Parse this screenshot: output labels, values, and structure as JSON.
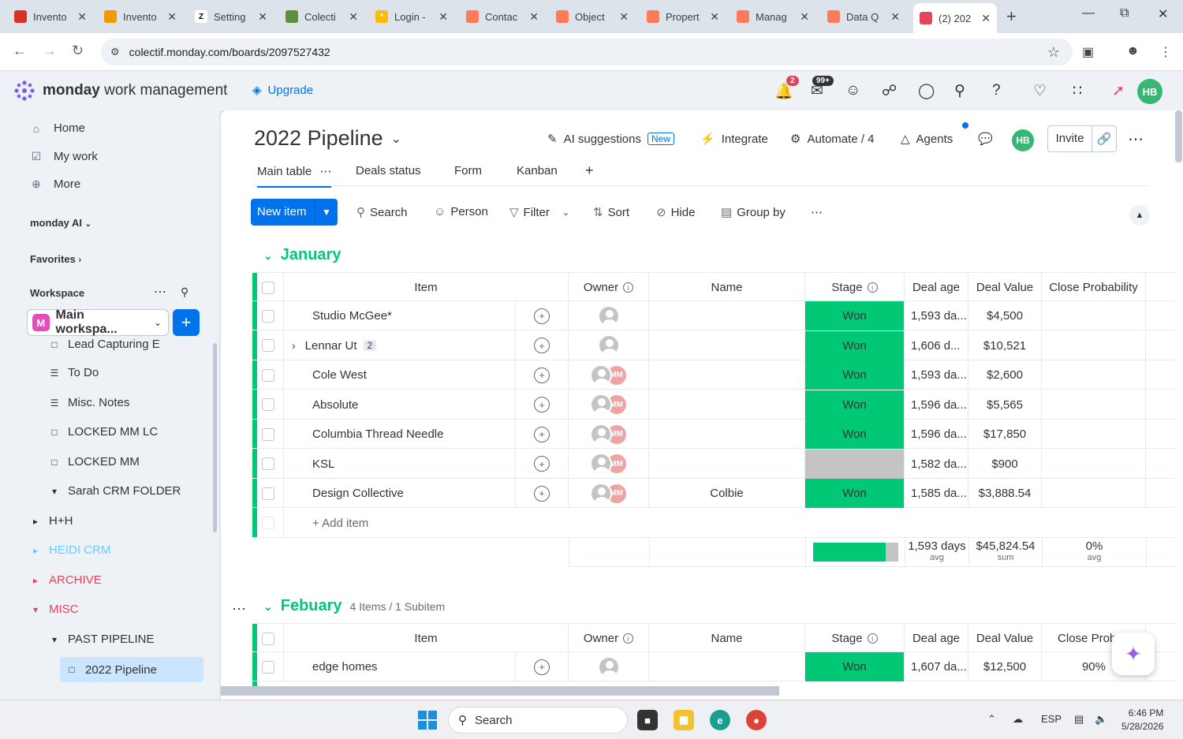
{
  "browser": {
    "tabs": [
      {
        "title": "Invento",
        "color": "#d93025",
        "glyph": ""
      },
      {
        "title": "Invento",
        "color": "#f29900",
        "glyph": ""
      },
      {
        "title": "Setting",
        "color": "#ffffff",
        "glyph": "Z"
      },
      {
        "title": "Colecti",
        "color": "#5e8e3e",
        "glyph": ""
      },
      {
        "title": "Login -",
        "color": "#fbbc04",
        "glyph": "*"
      },
      {
        "title": "Contac",
        "color": "#ff7a59",
        "glyph": ""
      },
      {
        "title": "Object",
        "color": "#ff7a59",
        "glyph": ""
      },
      {
        "title": "Propert",
        "color": "#ff7a59",
        "glyph": ""
      },
      {
        "title": "Manag",
        "color": "#ff7a59",
        "glyph": ""
      },
      {
        "title": "Data Q",
        "color": "#ff7a59",
        "glyph": ""
      },
      {
        "title": "(2) 202",
        "color": "#e2445c",
        "glyph": ""
      }
    ],
    "new_tab": "+",
    "url": "colectif.monday.com/boards/2097527432"
  },
  "header": {
    "brand_bold": "monday",
    "brand_rest": " work management",
    "upgrade": "Upgrade",
    "notif_count": "2",
    "inbox_count": "99+",
    "user_initials": "HB"
  },
  "sidebar": {
    "home": "Home",
    "my_work": "My work",
    "more": "More",
    "monday_ai": "monday AI",
    "favorites": "Favorites",
    "workspace_label": "Workspace",
    "workspace_letter": "M",
    "workspace_name": "Main workspa...",
    "items": [
      {
        "label": "Lead Capturing E",
        "color": "#323338"
      },
      {
        "label": "To Do",
        "color": "#323338"
      },
      {
        "label": "Misc. Notes",
        "color": "#323338"
      },
      {
        "label": "LOCKED MM LC",
        "color": "#323338"
      },
      {
        "label": "LOCKED MM",
        "color": "#323338"
      },
      {
        "label": "Sarah CRM FOLDER",
        "color": "#323338"
      },
      {
        "label": "H+H",
        "color": "#323338"
      },
      {
        "label": "HEIDI CRM",
        "color": "#66ccff"
      },
      {
        "label": "ARCHIVE",
        "color": "#e2445c"
      },
      {
        "label": "MISC",
        "color": "#e2445c"
      },
      {
        "label": "PAST PIPELINE",
        "color": "#323338"
      },
      {
        "label": "2022 Pipeline",
        "color": "#323338"
      }
    ]
  },
  "board": {
    "title": "2022 Pipeline",
    "ai_suggestions": "AI suggestions",
    "new_tag": "New",
    "integrate": "Integrate",
    "automate": "Automate / 4",
    "agents": "Agents",
    "avatar": "HB",
    "invite": "Invite",
    "views": [
      "Main table",
      "Deals status",
      "Form",
      "Kanban"
    ],
    "toolbar": {
      "new_item": "New item",
      "search": "Search",
      "person": "Person",
      "filter": "Filter",
      "sort": "Sort",
      "hide": "Hide",
      "group_by": "Group by"
    }
  },
  "columns": [
    "Item",
    "Owner",
    "Name",
    "Stage",
    "Deal age",
    "Deal Value",
    "Close Probability"
  ],
  "columns_feb_last": "Close Probab",
  "groups": [
    {
      "name": "January",
      "meta": "",
      "rows": [
        {
          "item": "Studio McGee*",
          "subitems": "",
          "owner": "gray",
          "name": "",
          "stage": "Won",
          "deal_age": "1,593 da...",
          "deal_value": "$4,500",
          "close": ""
        },
        {
          "item": "Lennar Ut",
          "subitems": "2",
          "owner": "gray",
          "name": "",
          "stage": "Won",
          "deal_age": "1,606 d...",
          "deal_value": "$10,521",
          "close": ""
        },
        {
          "item": "Cole West",
          "subitems": "",
          "owner": "mm",
          "name": "",
          "stage": "Won",
          "deal_age": "1,593 da...",
          "deal_value": "$2,600",
          "close": ""
        },
        {
          "item": "Absolute",
          "subitems": "",
          "owner": "mm",
          "name": "",
          "stage": "Won",
          "deal_age": "1,596 da...",
          "deal_value": "$5,565",
          "close": ""
        },
        {
          "item": "Columbia Thread Needle",
          "subitems": "",
          "owner": "mm",
          "name": "",
          "stage": "Won",
          "deal_age": "1,596 da...",
          "deal_value": "$17,850",
          "close": ""
        },
        {
          "item": "KSL",
          "subitems": "",
          "owner": "mm",
          "name": "",
          "stage": "",
          "deal_age": "1,582 da...",
          "deal_value": "$900",
          "close": ""
        },
        {
          "item": "Design Collective",
          "subitems": "",
          "owner": "mm",
          "name": "Colbie",
          "stage": "Won",
          "deal_age": "1,585 da...",
          "deal_value": "$3,888.54",
          "close": ""
        }
      ],
      "add_item": "+ Add item",
      "summary": {
        "stage_won_fraction": 0.86,
        "deal_age": "1,593 days",
        "deal_age_sub": "avg",
        "deal_value": "$45,824.54",
        "deal_value_sub": "sum",
        "close": "0%",
        "close_sub": "avg"
      }
    },
    {
      "name": "Febuary",
      "meta": "4 Items / 1 Subitem",
      "rows": [
        {
          "item": "edge homes",
          "subitems": "",
          "owner": "gray",
          "name": "",
          "stage": "Won",
          "deal_age": "1,607 da...",
          "deal_value": "$12,500",
          "close": "90%"
        }
      ]
    }
  ],
  "mm_initials": "MM",
  "taskbar": {
    "search": "Search",
    "lang": "ESP",
    "time": "6:46 PM",
    "date": "5/28/2026"
  }
}
